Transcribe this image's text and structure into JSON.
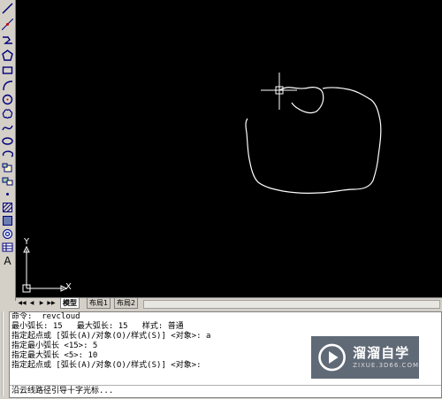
{
  "toolbar": {
    "tools": [
      {
        "icon": "line-icon"
      },
      {
        "icon": "construction-line-icon"
      },
      {
        "icon": "polyline-icon"
      },
      {
        "icon": "polygon-icon"
      },
      {
        "icon": "rectangle-icon"
      },
      {
        "icon": "arc-icon"
      },
      {
        "icon": "circle-icon"
      },
      {
        "icon": "revision-cloud-icon"
      },
      {
        "icon": "spline-icon"
      },
      {
        "icon": "ellipse-icon"
      },
      {
        "icon": "ellipse-arc-icon"
      },
      {
        "icon": "insert-block-icon"
      },
      {
        "icon": "make-block-icon"
      },
      {
        "icon": "point-icon"
      },
      {
        "icon": "hatch-icon"
      },
      {
        "icon": "gradient-icon"
      },
      {
        "icon": "region-icon"
      },
      {
        "icon": "table-icon"
      },
      {
        "icon": "multiline-text-icon",
        "label": "A"
      }
    ]
  },
  "canvas": {
    "background": "#000000",
    "stroke_color": "#ffffff",
    "ucs": {
      "x_label": "X",
      "y_label": "Y"
    }
  },
  "tabs": [
    {
      "label": "模型",
      "active": true
    },
    {
      "label": "布局1",
      "active": false
    },
    {
      "label": "布局2",
      "active": false
    }
  ],
  "command_window": {
    "lines": [
      "命令:  revcloud",
      "最小弧长: 15   最大弧长: 15   样式: 普通",
      "指定起点或 [弧长(A)/对象(O)/样式(S)] <对象>: a",
      "指定最小弧长 <15>: 5",
      "指定最大弧长 <5>: 10",
      "指定起点或 [弧长(A)/对象(O)/样式(S)] <对象>:"
    ],
    "prompt": "沿云线路径引导十字光标..."
  },
  "watermark": {
    "title": "溜溜自学",
    "subtitle": "ZIXUE.3D66.COM"
  }
}
